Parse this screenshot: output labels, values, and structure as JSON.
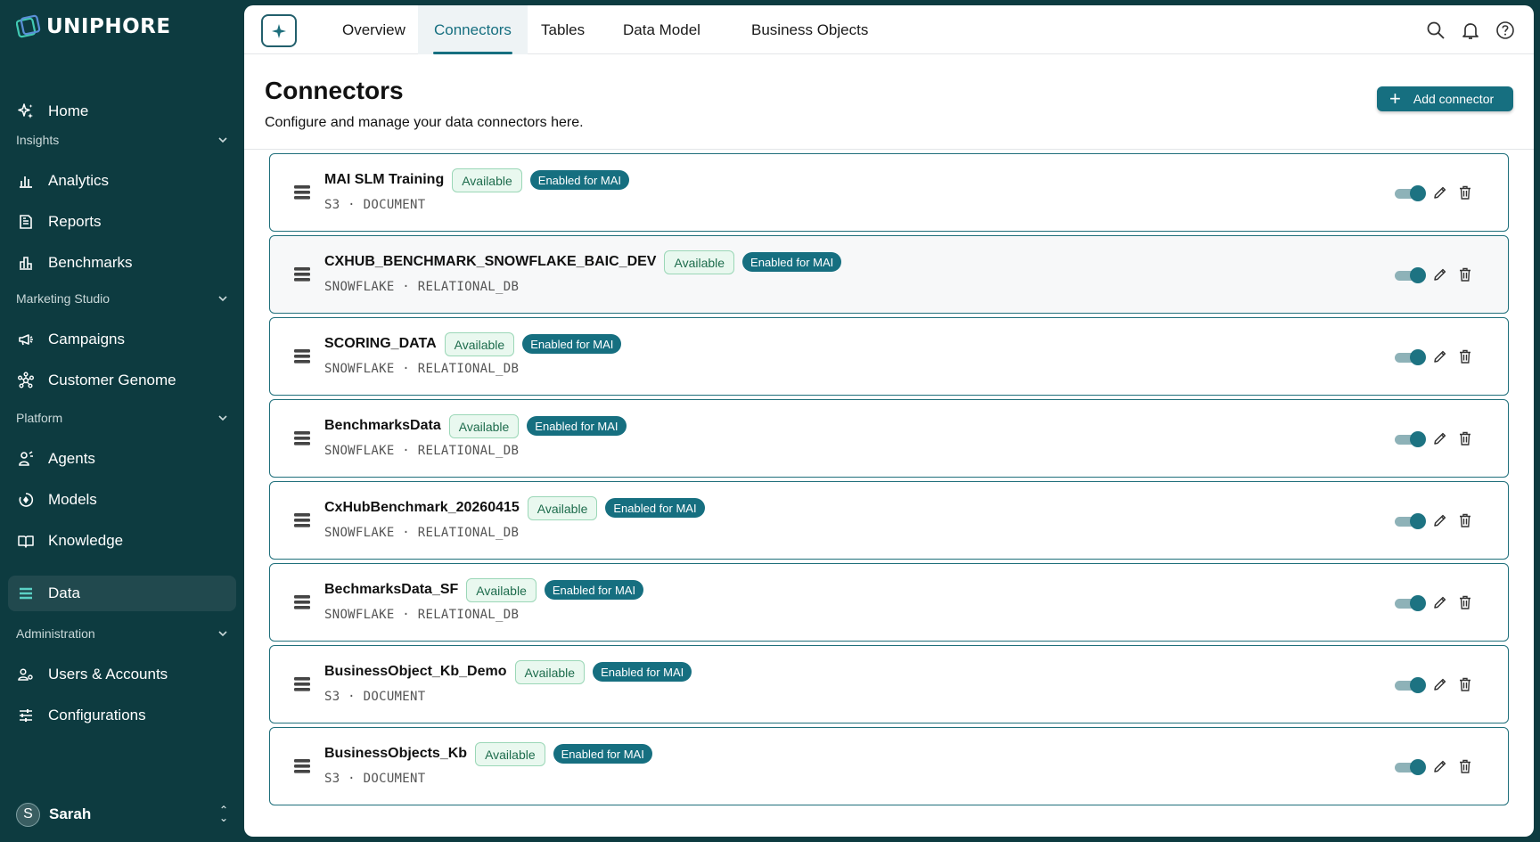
{
  "brand": {
    "name": "UNIPHORE"
  },
  "sidebar": {
    "home": "Home",
    "sections": [
      {
        "label": "Insights",
        "items": [
          "Analytics",
          "Reports",
          "Benchmarks"
        ]
      },
      {
        "label": "Marketing Studio",
        "items": [
          "Campaigns",
          "Customer Genome"
        ]
      },
      {
        "label": "Platform",
        "items": [
          "Agents",
          "Models",
          "Knowledge",
          "Data"
        ]
      },
      {
        "label": "Administration",
        "items": [
          "Users & Accounts",
          "Configurations"
        ]
      }
    ],
    "active_item": "Data",
    "user": {
      "initial": "S",
      "name": "Sarah"
    }
  },
  "tabs": [
    {
      "label": "Overview",
      "active": false
    },
    {
      "label": "Connectors",
      "active": true
    },
    {
      "label": "Tables",
      "active": false
    },
    {
      "label": "Data Model",
      "active": false
    },
    {
      "label": "Business Objects",
      "active": false
    }
  ],
  "header": {
    "title": "Connectors",
    "subtitle": "Configure and manage your data connectors here.",
    "add_button": "Add connector"
  },
  "status_labels": {
    "available": "Available",
    "mai": "Enabled for MAI"
  },
  "connectors": [
    {
      "name": "MAI SLM Training",
      "source": "S3",
      "kind": "DOCUMENT",
      "enabled": true
    },
    {
      "name": "CXHUB_BENCHMARK_SNOWFLAKE_BAIC_DEV",
      "source": "SNOWFLAKE",
      "kind": "RELATIONAL_DB",
      "enabled": true
    },
    {
      "name": "SCORING_DATA",
      "source": "SNOWFLAKE",
      "kind": "RELATIONAL_DB",
      "enabled": true
    },
    {
      "name": "BenchmarksData",
      "source": "SNOWFLAKE",
      "kind": "RELATIONAL_DB",
      "enabled": true
    },
    {
      "name": "CxHubBenchmark_20260415",
      "source": "SNOWFLAKE",
      "kind": "RELATIONAL_DB",
      "enabled": true
    },
    {
      "name": "BechmarksData_SF",
      "source": "SNOWFLAKE",
      "kind": "RELATIONAL_DB",
      "enabled": true
    },
    {
      "name": "BusinessObject_Kb_Demo",
      "source": "S3",
      "kind": "DOCUMENT",
      "enabled": true
    },
    {
      "name": "BusinessObjects_Kb",
      "source": "S3",
      "kind": "DOCUMENT",
      "enabled": true
    }
  ],
  "colors": {
    "sidebar": "#0d3b40",
    "accent": "#166f80",
    "active_icon": "#5bd1c5"
  }
}
